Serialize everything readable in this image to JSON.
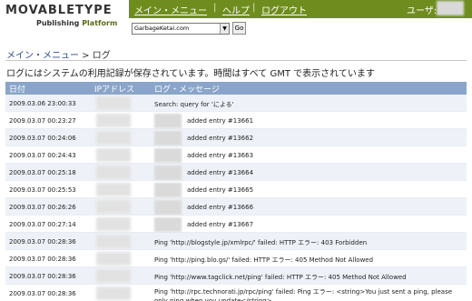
{
  "logo": {
    "main": "MOVABLETYPE",
    "publishing": "Publishing",
    "platform": "Platform"
  },
  "nav": {
    "main_menu": "メイン・メニュー",
    "sep": "|",
    "help": "ヘルプ",
    "logout": "ログアウト",
    "user_label": "ユーザ:"
  },
  "blog_select": {
    "value": "GarbageKetai.com",
    "go_label": "Go"
  },
  "breadcrumb": {
    "menu": "メイン・メニュー",
    "sep": " > ",
    "current": "ログ"
  },
  "info_text": "ログにはシステムの利用記録が保存されています。時間はすべて GMT で表示されています",
  "table": {
    "headers": {
      "date": "日付",
      "ip": "IPアドレス",
      "message": "ログ・メッセージ"
    },
    "rows": [
      {
        "date": "2009.03.06 23:00:33",
        "message": "Search: query for 'による'"
      },
      {
        "date": "2009.03.07 00:23:27",
        "message": "added entry #13661"
      },
      {
        "date": "2009.03.07 00:24:06",
        "message": "added entry #13662"
      },
      {
        "date": "2009.03.07 00:24:43",
        "message": "added entry #13663"
      },
      {
        "date": "2009.03.07 00:25:18",
        "message": "added entry #13664"
      },
      {
        "date": "2009.03.07 00:25:53",
        "message": "added entry #13665"
      },
      {
        "date": "2009.03.07 00:26:26",
        "message": "added entry #13666"
      },
      {
        "date": "2009.03.07 00:27:14",
        "message": "added entry #13667"
      },
      {
        "date": "2009.03.07 00:28:36",
        "message": "Ping 'http://blogstyle.jp/xmlrpc/' failed: HTTP エラー: 403 Forbidden"
      },
      {
        "date": "2009.03.07 00:28:36",
        "message": "Ping 'http://ping.blo.gs/' failed: HTTP エラー: 405 Method Not Allowed"
      },
      {
        "date": "2009.03.07 00:28:36",
        "message": "Ping 'http://www.tagclick.net/ping' failed: HTTP エラー: 405 Method Not Allowed"
      },
      {
        "date": "2009.03.07 00:28:36",
        "message": "Ping 'http://rpc.technorati.jp/rpc/ping' failed: Ping エラー: <string>You just sent a ping, please only ping when you update</string>"
      }
    ]
  },
  "colors": {
    "nav_bg": "#6f8d1f",
    "table_header_bg": "#8aa5c9",
    "row_alt_bg": "#eef2f8",
    "link": "#2d4b8c"
  }
}
